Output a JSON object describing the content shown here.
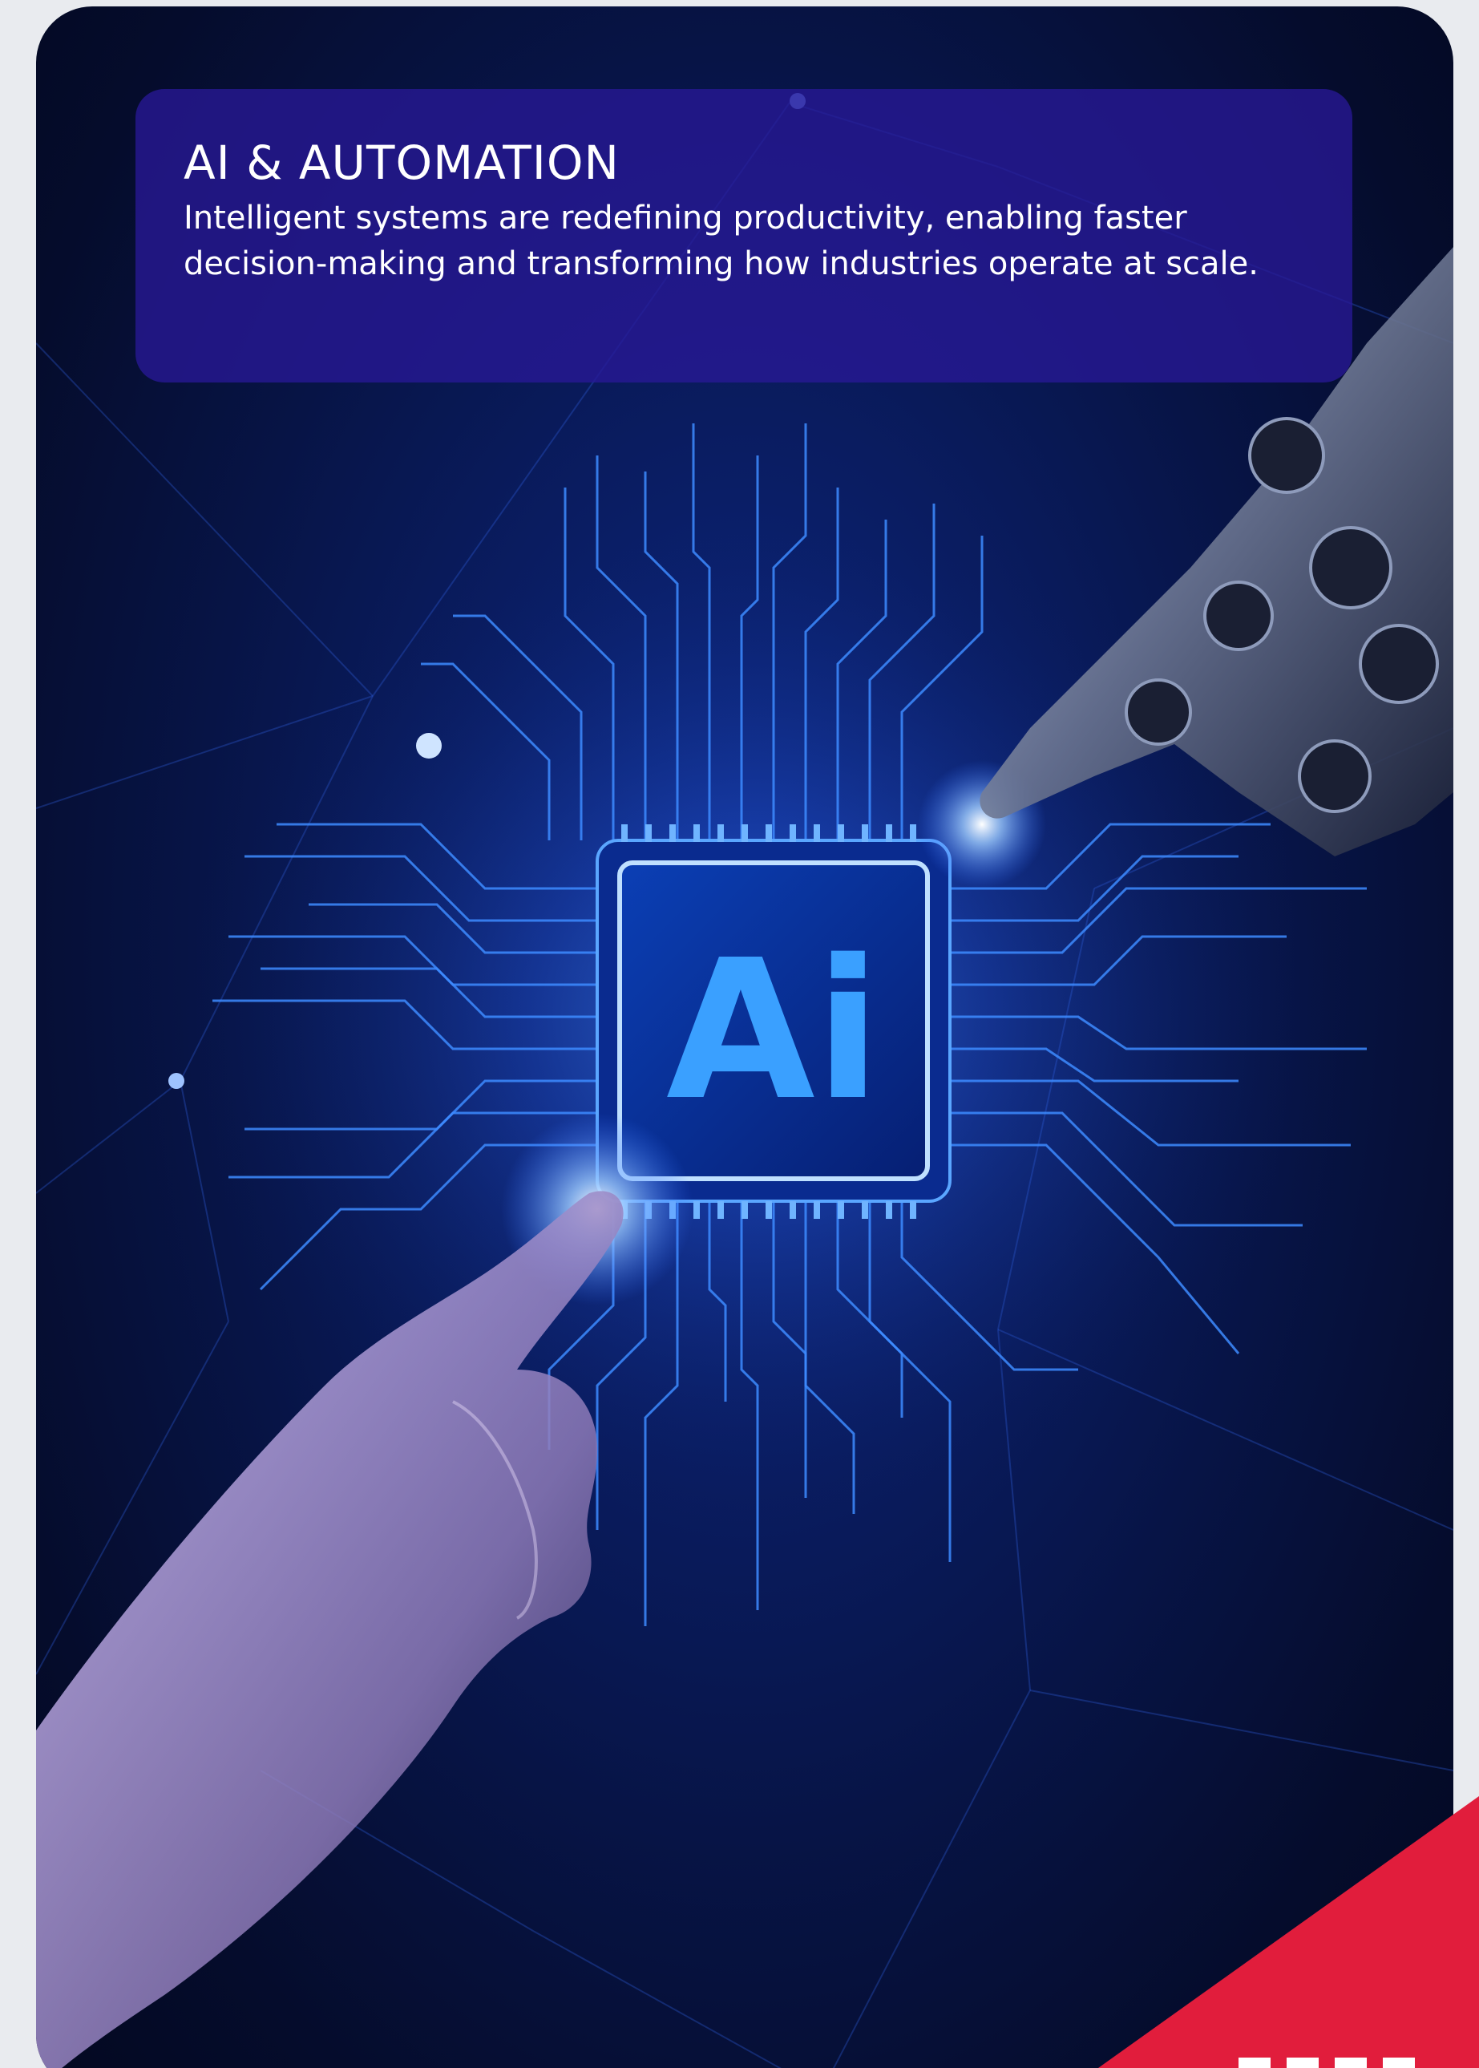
{
  "banner": {
    "title": "AI & AUTOMATION",
    "body": "Intelligent systems are redefining productivity, enabling faster decision-making and transforming how industries operate at scale."
  },
  "chip": {
    "label": "Ai"
  },
  "colors": {
    "page_background": "#e9ebef",
    "card_background": "#071446",
    "banner_background": "#2a189a",
    "circuit_glow": "#3d8bff",
    "chip_text": "#3aa0ff",
    "accent_red": "#e11d3c"
  },
  "icons": {
    "hero_image": "ai-chip-hand-robot-illustration"
  }
}
